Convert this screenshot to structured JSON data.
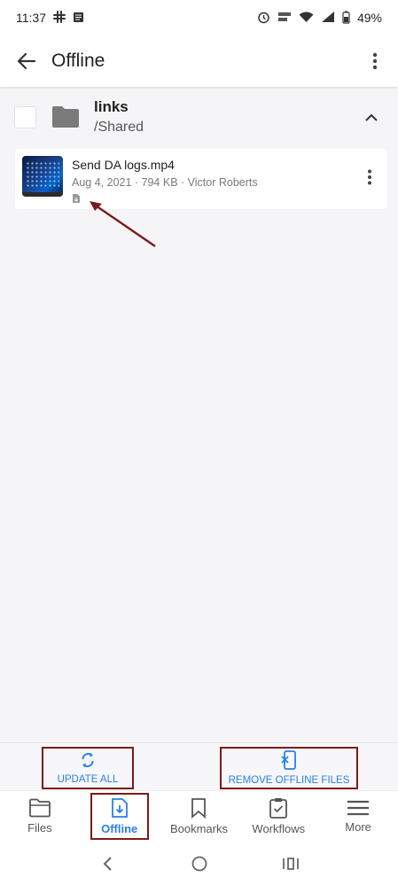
{
  "status": {
    "time": "11:37",
    "battery": "49%",
    "icons_left": [
      "slack-icon",
      "notes-icon"
    ],
    "icons_right": [
      "alarm-icon",
      "volte-icon",
      "wifi-icon",
      "signal-icon",
      "battery-icon"
    ]
  },
  "header": {
    "title": "Offline"
  },
  "folder": {
    "name": "links",
    "path": "/Shared"
  },
  "file": {
    "name": "Send DA logs.mp4",
    "meta": "Aug 4, 2021 · 794 KB · Victor Roberts"
  },
  "actions": {
    "update_all": "UPDATE ALL",
    "remove_offline": "REMOVE OFFLINE FILES"
  },
  "nav": {
    "files": "Files",
    "offline": "Offline",
    "bookmarks": "Bookmarks",
    "workflows": "Workflows",
    "more": "More"
  },
  "colors": {
    "accent": "#2a7fe6",
    "annotation": "#7b1a1a",
    "folder": "#7a7a7a"
  }
}
